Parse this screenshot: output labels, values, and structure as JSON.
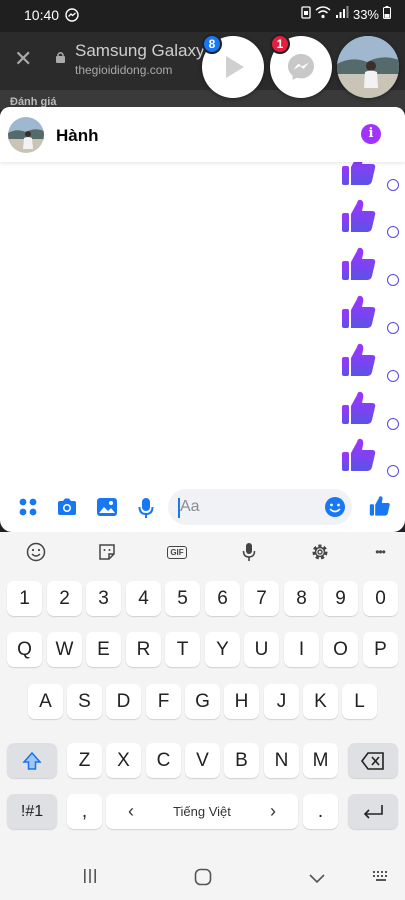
{
  "status_bar": {
    "time": "10:40",
    "battery": "33%"
  },
  "browser": {
    "title": "Samsung Galaxy",
    "url": "thegioididong.com",
    "strip_text": "Đánh giá"
  },
  "chat_heads": [
    {
      "name": "video",
      "badge": "8",
      "badge_color": "#1877f2"
    },
    {
      "name": "messenger",
      "badge": "1",
      "badge_color": "#e41e3f"
    },
    {
      "name": "contact"
    }
  ],
  "chat": {
    "contact_name": "Hành",
    "info_label": "i",
    "likes": [
      1,
      2,
      3,
      4,
      5,
      6,
      7
    ],
    "input_placeholder": "Aa"
  },
  "keyboard": {
    "toolbar": [
      "emoji-icon",
      "sticker-icon",
      "gif-icon",
      "mic-icon",
      "settings-icon",
      "more-icon"
    ],
    "gif_label": "GIF",
    "more_label": "•••",
    "row_numbers": [
      "1",
      "2",
      "3",
      "4",
      "5",
      "6",
      "7",
      "8",
      "9",
      "0"
    ],
    "row_q": [
      "Q",
      "W",
      "E",
      "R",
      "T",
      "Y",
      "U",
      "I",
      "O",
      "P"
    ],
    "row_a": [
      "A",
      "S",
      "D",
      "F",
      "G",
      "H",
      "J",
      "K",
      "L"
    ],
    "row_z": [
      "Z",
      "X",
      "C",
      "V",
      "B",
      "N",
      "M"
    ],
    "symbols_label": "!#1",
    "comma_label": ",",
    "space_label": "Tiếng Việt",
    "space_left": "‹",
    "space_right": "›",
    "period_label": "."
  },
  "colors": {
    "messenger_blue": "#1877f2",
    "like_start": "#a033ff",
    "like_end": "#4f5bd5"
  }
}
